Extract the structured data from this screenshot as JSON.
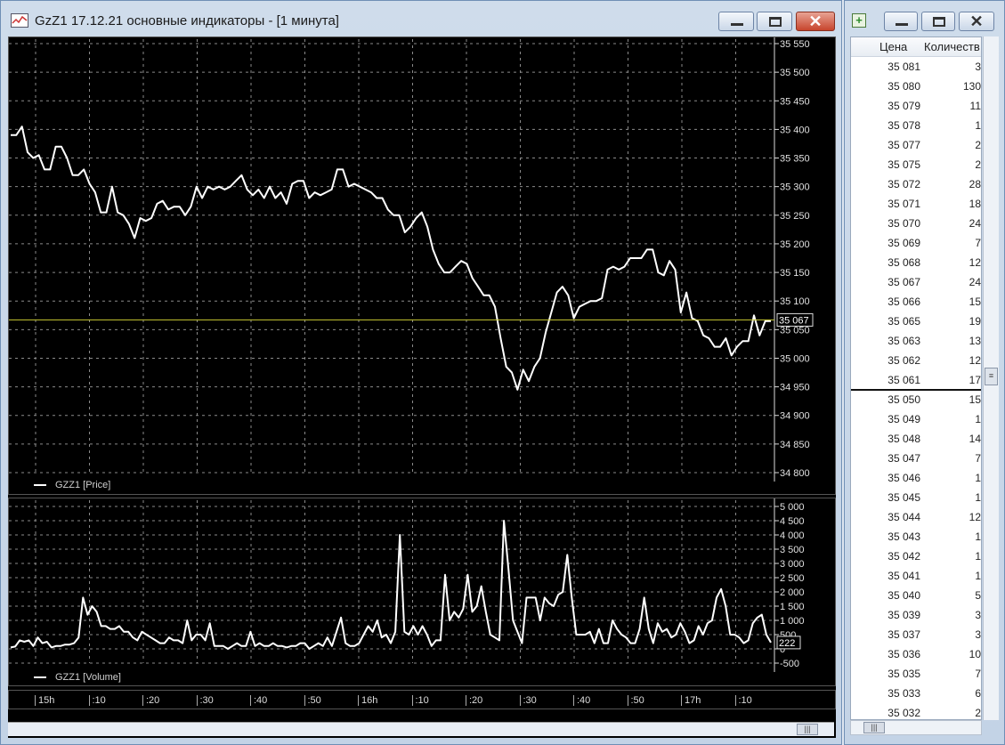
{
  "chart_window": {
    "title": "GzZ1 17.12.21 основные индикаторы - [1 минута]",
    "close_glyph": "✕"
  },
  "price_pane": {
    "legend": "GZZ1 [Price]",
    "current_price_label": "35 067",
    "current_price": 35067,
    "line_color": "#ffffff",
    "current_line_color": "#c8c832"
  },
  "volume_pane": {
    "legend": "GZZ1 [Volume]",
    "current_volume_label": "222"
  },
  "time_axis": {
    "labels": [
      "15h",
      ":10",
      ":20",
      ":30",
      ":40",
      ":50",
      "16h",
      ":10",
      ":20",
      ":30",
      ":40",
      ":50",
      "17h",
      ":10"
    ]
  },
  "chart_data": [
    {
      "type": "line",
      "series": [
        {
          "name": "GZZ1 [Price]",
          "values": [
            35390,
            35390,
            35405,
            35360,
            35350,
            35355,
            35330,
            35330,
            35370,
            35370,
            35350,
            35320,
            35320,
            35330,
            35305,
            35290,
            35255,
            35255,
            35300,
            35255,
            35250,
            35235,
            35210,
            35245,
            35240,
            35245,
            35270,
            35275,
            35260,
            35265,
            35265,
            35250,
            35265,
            35300,
            35280,
            35300,
            35295,
            35300,
            35295,
            35300,
            35310,
            35320,
            35295,
            35285,
            35295,
            35280,
            35300,
            35280,
            35290,
            35270,
            35305,
            35310,
            35310,
            35280,
            35290,
            35285,
            35290,
            35295,
            35330,
            35330,
            35300,
            35305,
            35300,
            35295,
            35290,
            35280,
            35280,
            35260,
            35250,
            35250,
            35220,
            35230,
            35245,
            35255,
            35230,
            35190,
            35165,
            35150,
            35150,
            35160,
            35170,
            35165,
            35140,
            35125,
            35110,
            35110,
            35090,
            35035,
            34985,
            34975,
            34945,
            34980,
            34960,
            34985,
            35000,
            35045,
            35080,
            35115,
            35125,
            35110,
            35070,
            35090,
            35095,
            35100,
            35100,
            35105,
            35155,
            35160,
            35155,
            35160,
            35175,
            35175,
            35175,
            35190,
            35190,
            35150,
            35145,
            35170,
            35155,
            35080,
            35115,
            35070,
            35065,
            35040,
            35035,
            35020,
            35020,
            35035,
            35005,
            35020,
            35030,
            35030,
            35075,
            35040,
            35065,
            35065
          ]
        }
      ],
      "ylim": [
        34800,
        35550
      ],
      "yticks": [
        35550,
        35500,
        35450,
        35400,
        35350,
        35300,
        35250,
        35200,
        35150,
        35100,
        35050,
        35000,
        34950,
        34900,
        34850,
        34800
      ],
      "ytick_labels": [
        "35 550",
        "35 500",
        "35 450",
        "35 400",
        "35 350",
        "35 300",
        "35 250",
        "35 200",
        "35 150",
        "35 100",
        "35 050",
        "35 000",
        "34 950",
        "34 900",
        "34 850",
        "34 800"
      ],
      "grid": true
    },
    {
      "type": "line",
      "series": [
        {
          "name": "GZZ1 [Volume]",
          "values": [
            50,
            80,
            300,
            250,
            300,
            100,
            400,
            200,
            250,
            50,
            100,
            100,
            150,
            150,
            200,
            400,
            1800,
            1200,
            1500,
            1300,
            800,
            800,
            700,
            700,
            800,
            600,
            600,
            400,
            300,
            600,
            500,
            400,
            300,
            200,
            200,
            400,
            300,
            300,
            200,
            1000,
            300,
            500,
            500,
            300,
            900,
            100,
            100,
            100,
            0,
            100,
            200,
            100,
            100,
            600,
            100,
            200,
            100,
            100,
            200,
            100,
            100,
            50,
            100,
            100,
            200,
            200,
            0,
            100,
            200,
            100,
            400,
            100,
            600,
            1100,
            200,
            100,
            100,
            200,
            500,
            800,
            600,
            1000,
            400,
            500,
            200,
            600,
            4000,
            600,
            500,
            800,
            500,
            800,
            500,
            100,
            300,
            300,
            2600,
            1000,
            1300,
            1100,
            1400,
            2600,
            1300,
            1500,
            2200,
            1300,
            500,
            400,
            300,
            4500,
            2800,
            1000,
            600,
            200,
            1800,
            1800,
            1800,
            1000,
            1800,
            1600,
            1500,
            1900,
            2000,
            3300,
            1800,
            500,
            500,
            500,
            600,
            200,
            700,
            200,
            200,
            1000,
            700,
            500,
            400,
            200,
            200,
            700,
            1800,
            700,
            200,
            900,
            600,
            700,
            400,
            500,
            900,
            600,
            200,
            300,
            800,
            500,
            900,
            1000,
            1800,
            2100,
            1500,
            500,
            500,
            400,
            200,
            300,
            900,
            1100,
            1200,
            500,
            222
          ]
        }
      ],
      "ylim": [
        -500,
        5000
      ],
      "yticks": [
        5000,
        4500,
        4000,
        3500,
        3000,
        2500,
        2000,
        1500,
        1000,
        500,
        0,
        -500
      ],
      "ytick_labels": [
        "5 000",
        "4 500",
        "4 000",
        "3 500",
        "3 000",
        "2 500",
        "2 000",
        "1 500",
        "1 000",
        "500",
        "0",
        "-500"
      ],
      "grid": true
    }
  ],
  "order_book": {
    "header_price": "Цена",
    "header_qty": "Количеств",
    "asks": [
      {
        "price": "35 081",
        "qty": "3"
      },
      {
        "price": "35 080",
        "qty": "130"
      },
      {
        "price": "35 079",
        "qty": "11"
      },
      {
        "price": "35 078",
        "qty": "1"
      },
      {
        "price": "35 077",
        "qty": "2"
      },
      {
        "price": "35 075",
        "qty": "2"
      },
      {
        "price": "35 072",
        "qty": "28"
      },
      {
        "price": "35 071",
        "qty": "18"
      },
      {
        "price": "35 070",
        "qty": "24"
      },
      {
        "price": "35 069",
        "qty": "7"
      },
      {
        "price": "35 068",
        "qty": "12"
      },
      {
        "price": "35 067",
        "qty": "24"
      },
      {
        "price": "35 066",
        "qty": "15"
      },
      {
        "price": "35 065",
        "qty": "19"
      },
      {
        "price": "35 063",
        "qty": "13"
      },
      {
        "price": "35 062",
        "qty": "12"
      },
      {
        "price": "35 061",
        "qty": "17"
      }
    ],
    "bids": [
      {
        "price": "35 050",
        "qty": "15"
      },
      {
        "price": "35 049",
        "qty": "1"
      },
      {
        "price": "35 048",
        "qty": "14"
      },
      {
        "price": "35 047",
        "qty": "7"
      },
      {
        "price": "35 046",
        "qty": "1"
      },
      {
        "price": "35 045",
        "qty": "1"
      },
      {
        "price": "35 044",
        "qty": "12"
      },
      {
        "price": "35 043",
        "qty": "1"
      },
      {
        "price": "35 042",
        "qty": "1"
      },
      {
        "price": "35 041",
        "qty": "1"
      },
      {
        "price": "35 040",
        "qty": "5"
      },
      {
        "price": "35 039",
        "qty": "3"
      },
      {
        "price": "35 037",
        "qty": "3"
      },
      {
        "price": "35 036",
        "qty": "10"
      },
      {
        "price": "35 035",
        "qty": "7"
      },
      {
        "price": "35 033",
        "qty": "6"
      },
      {
        "price": "35 032",
        "qty": "2"
      }
    ]
  }
}
